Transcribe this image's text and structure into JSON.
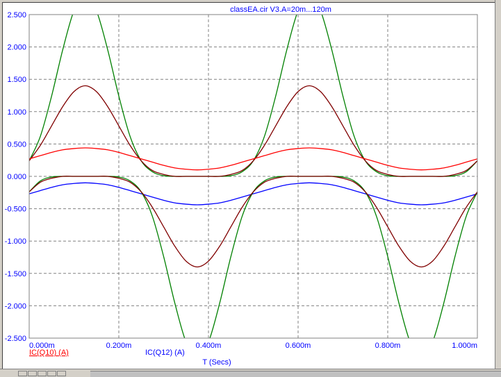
{
  "chart_data": {
    "type": "line",
    "title": "classEA.cir V3.A=20m...120m",
    "xlabel": "T (Secs)",
    "xlim": [
      0,
      1.0
    ],
    "ylim": [
      -2.5,
      2.5
    ],
    "grid": true,
    "x_ticks": [
      0,
      0.2,
      0.4,
      0.6,
      0.8,
      1.0
    ],
    "x_tick_labels": [
      "0.000m",
      "0.200m",
      "0.400m",
      "0.600m",
      "0.800m",
      "1.000m"
    ],
    "y_ticks": [
      2.5,
      2.0,
      1.5,
      1.0,
      0.5,
      0,
      -0.5,
      -1.0,
      -1.5,
      -2.0,
      -2.5
    ],
    "y_tick_labels": [
      "2.500",
      "2.000",
      "1.500",
      "1.000",
      "0.500",
      "0.000",
      "-0.500",
      "-1.000",
      "-1.500",
      "-2.000",
      "-2.500"
    ],
    "x_step": 0.025,
    "legend": [
      {
        "label": "IC(Q10) (A)",
        "color": "#ff0000"
      },
      {
        "label": "IC(Q12) (A)",
        "color": "#0000ff"
      }
    ],
    "series": [
      {
        "color": "#008000",
        "values": [
          0.24,
          0.62,
          1.24,
          1.96,
          2.56,
          2.8,
          2.56,
          1.96,
          1.24,
          0.62,
          0.24,
          0.07,
          0.01,
          0,
          0,
          0,
          0,
          0,
          0.01,
          0.07,
          0.24,
          0.62,
          1.24,
          1.96,
          2.56,
          2.8,
          2.56,
          1.96,
          1.24,
          0.62,
          0.24,
          0.07,
          0.01,
          0,
          0,
          0,
          0,
          0,
          0.01,
          0.07,
          0.24
        ]
      },
      {
        "color": "#800000",
        "values": [
          0.24,
          0.48,
          0.78,
          1.08,
          1.31,
          1.4,
          1.31,
          1.08,
          0.78,
          0.48,
          0.24,
          0.09,
          0.03,
          0,
          0,
          0,
          0,
          0,
          0.03,
          0.09,
          0.24,
          0.48,
          0.78,
          1.08,
          1.31,
          1.4,
          1.31,
          1.08,
          0.78,
          0.48,
          0.24,
          0.09,
          0.03,
          0,
          0,
          0,
          0,
          0,
          0.03,
          0.09,
          0.24
        ]
      },
      {
        "name": "IC(Q10) (A)",
        "color": "#ff0000",
        "values": [
          0.27,
          0.32,
          0.37,
          0.41,
          0.43,
          0.44,
          0.43,
          0.41,
          0.37,
          0.32,
          0.27,
          0.22,
          0.17,
          0.13,
          0.11,
          0.1,
          0.11,
          0.13,
          0.17,
          0.22,
          0.27,
          0.32,
          0.37,
          0.41,
          0.43,
          0.44,
          0.43,
          0.41,
          0.37,
          0.32,
          0.27,
          0.22,
          0.17,
          0.13,
          0.11,
          0.1,
          0.11,
          0.13,
          0.17,
          0.22,
          0.27
        ]
      },
      {
        "name": "IC(Q12) (A)",
        "color": "#0000ff",
        "values": [
          -0.27,
          -0.22,
          -0.17,
          -0.13,
          -0.11,
          -0.1,
          -0.11,
          -0.13,
          -0.17,
          -0.22,
          -0.27,
          -0.32,
          -0.37,
          -0.41,
          -0.43,
          -0.44,
          -0.43,
          -0.41,
          -0.37,
          -0.32,
          -0.27,
          -0.22,
          -0.17,
          -0.13,
          -0.11,
          -0.1,
          -0.11,
          -0.13,
          -0.17,
          -0.22,
          -0.27,
          -0.32,
          -0.37,
          -0.41,
          -0.43,
          -0.44,
          -0.43,
          -0.41,
          -0.37,
          -0.32,
          -0.27
        ]
      },
      {
        "color": "#008000",
        "values": [
          -0.24,
          -0.07,
          -0.01,
          0,
          0,
          0,
          0,
          0,
          -0.01,
          -0.07,
          -0.24,
          -0.62,
          -1.24,
          -1.96,
          -2.56,
          -2.8,
          -2.56,
          -1.96,
          -1.24,
          -0.62,
          -0.24,
          -0.07,
          -0.01,
          0,
          0,
          0,
          0,
          0,
          -0.01,
          -0.07,
          -0.24,
          -0.62,
          -1.24,
          -1.96,
          -2.56,
          -2.8,
          -2.56,
          -1.96,
          -1.24,
          -0.62,
          -0.24
        ]
      },
      {
        "color": "#800000",
        "values": [
          -0.24,
          -0.09,
          -0.03,
          0,
          0,
          0,
          0,
          0,
          -0.03,
          -0.09,
          -0.24,
          -0.48,
          -0.78,
          -1.08,
          -1.31,
          -1.4,
          -1.31,
          -1.08,
          -0.78,
          -0.48,
          -0.24,
          -0.09,
          -0.03,
          0,
          0,
          0,
          0,
          0,
          -0.03,
          -0.09,
          -0.24,
          -0.48,
          -0.78,
          -1.08,
          -1.31,
          -1.4,
          -1.31,
          -1.08,
          -0.78,
          -0.48,
          -0.24
        ]
      }
    ]
  }
}
